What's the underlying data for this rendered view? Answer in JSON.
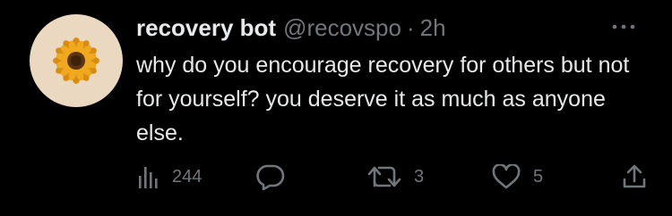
{
  "tweet": {
    "display_name": "recovery bot",
    "handle": "@recovspo",
    "separator": "·",
    "time": "2h",
    "text": "why do you encourage recovery for others but not for yourself? you deserve it as much as anyone else.",
    "avatar": {
      "icon": "sunflower-icon",
      "background": "#ead8c1"
    }
  },
  "actions": {
    "views": {
      "icon": "views-icon",
      "count": "244"
    },
    "reply": {
      "icon": "reply-icon"
    },
    "retweet": {
      "icon": "retweet-icon",
      "count": "3"
    },
    "like": {
      "icon": "like-icon",
      "count": "5"
    },
    "share": {
      "icon": "share-icon"
    },
    "more": {
      "icon": "more-icon"
    }
  },
  "colors": {
    "background": "#000000",
    "primary_text": "#e7e9ea",
    "secondary_text": "#71767b"
  }
}
